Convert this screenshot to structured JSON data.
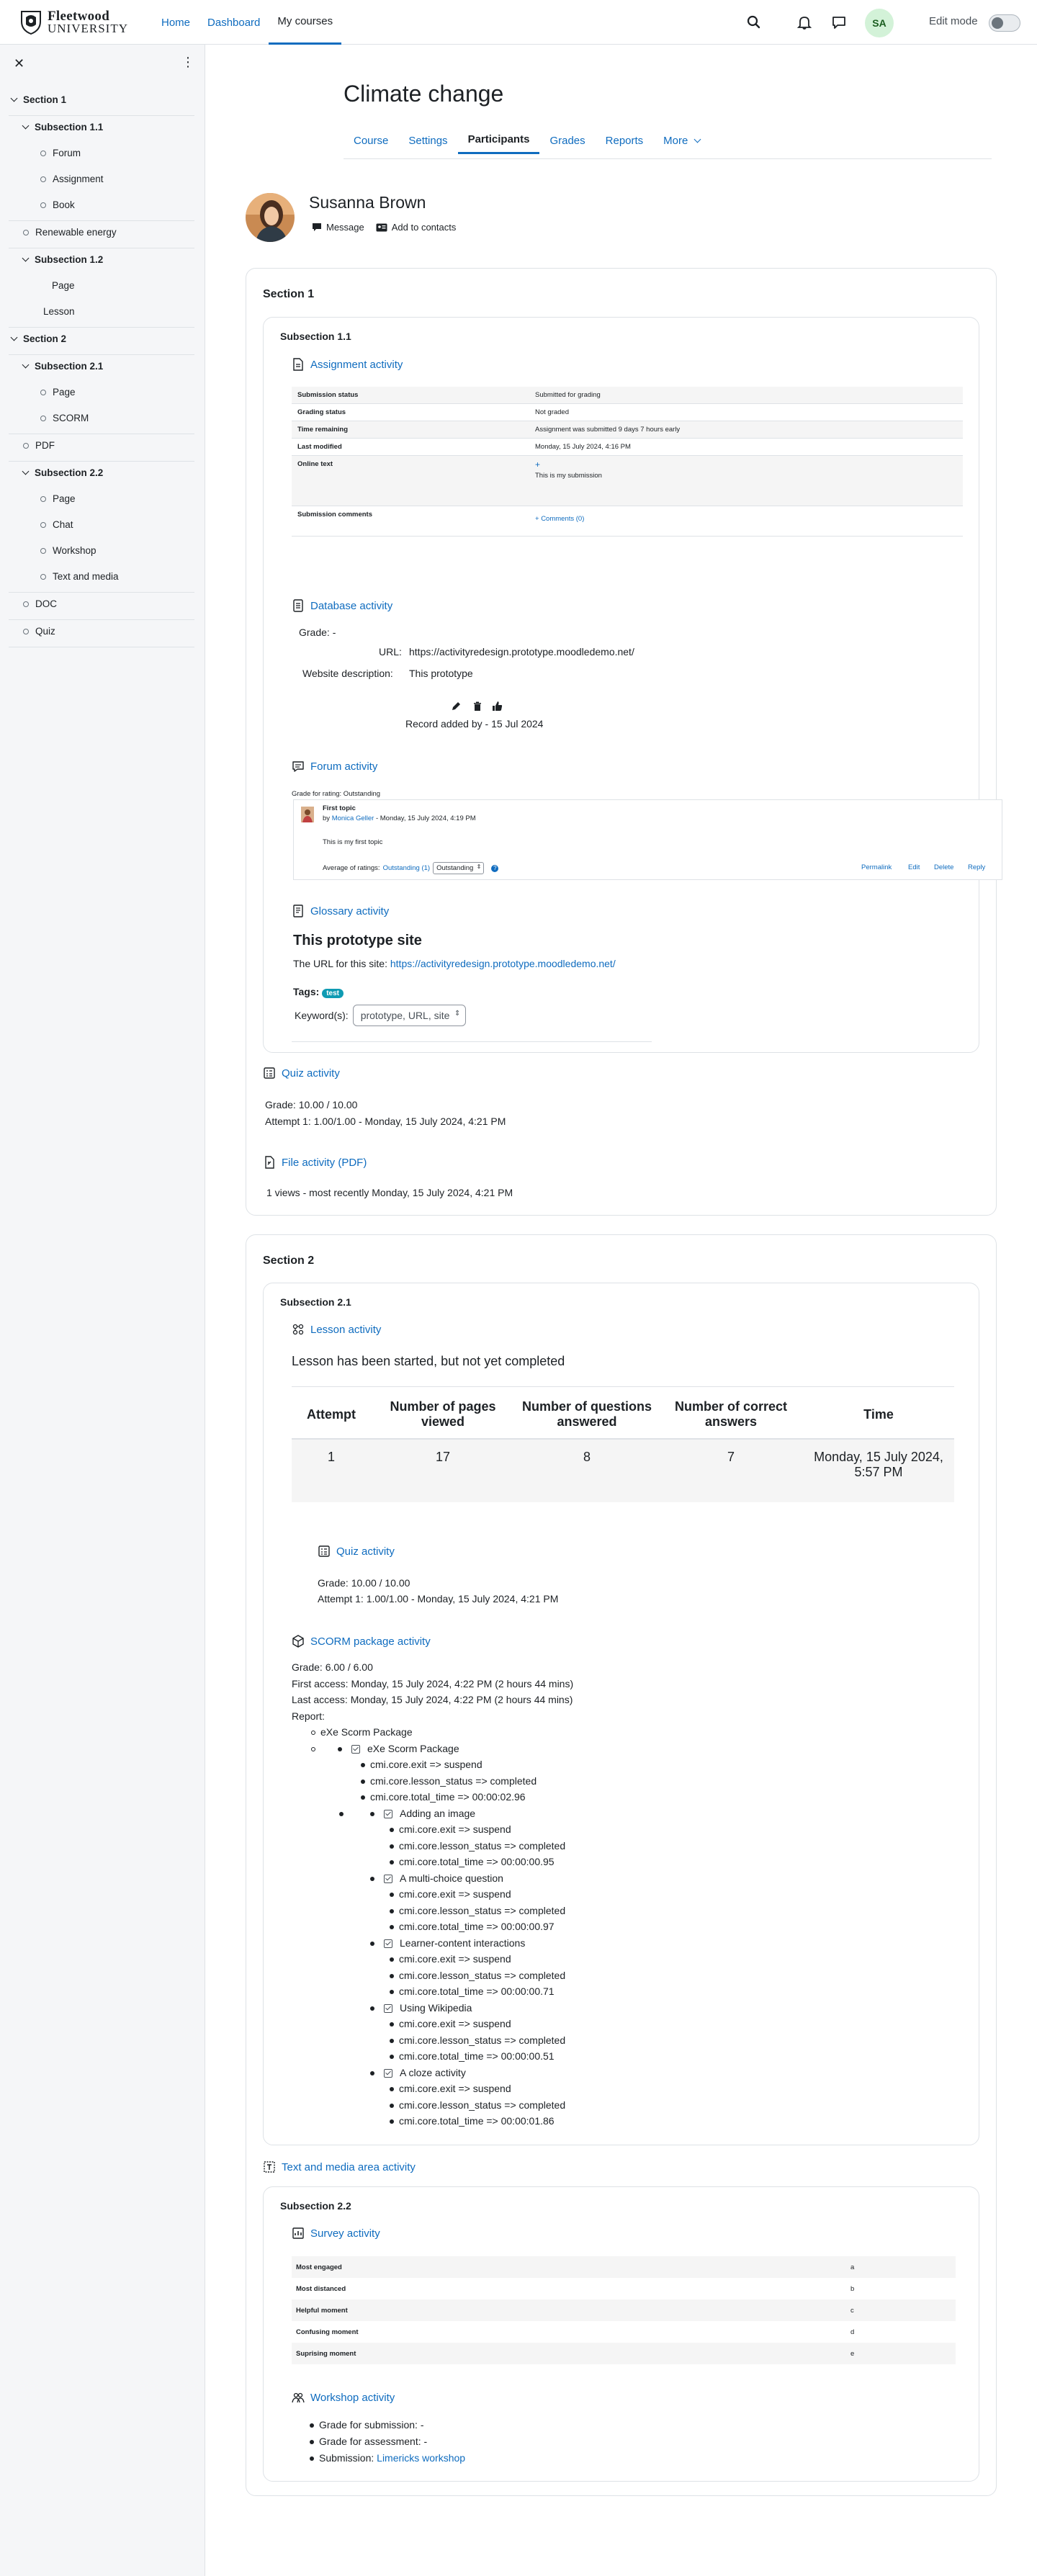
{
  "brand": {
    "line1": "Fleetwood",
    "line2": "UNIVERSITY"
  },
  "nav": {
    "items": [
      {
        "label": "Home",
        "active": false
      },
      {
        "label": "Dashboard",
        "active": false
      },
      {
        "label": "My courses",
        "active": true
      }
    ]
  },
  "user": {
    "initials": "SA",
    "edit_mode_label": "Edit mode"
  },
  "drawer": {
    "items": [
      {
        "label": "Section 1"
      },
      {
        "label": "Subsection 1.1"
      },
      {
        "label": "Forum"
      },
      {
        "label": "Assignment"
      },
      {
        "label": "Book"
      },
      {
        "label": "Renewable energy"
      },
      {
        "label": "Subsection 1.2"
      },
      {
        "label": "Page"
      },
      {
        "label": "Lesson"
      },
      {
        "label": "Section 2"
      },
      {
        "label": "Subsection 2.1"
      },
      {
        "label": "Page"
      },
      {
        "label": "SCORM"
      },
      {
        "label": "PDF"
      },
      {
        "label": "Subsection 2.2"
      },
      {
        "label": "Page"
      },
      {
        "label": "Chat"
      },
      {
        "label": "Workshop"
      },
      {
        "label": "Text and media"
      },
      {
        "label": "DOC"
      },
      {
        "label": "Quiz"
      }
    ]
  },
  "course": {
    "title": "Climate change",
    "tabs": [
      "Course",
      "Settings",
      "Participants",
      "Grades",
      "Reports",
      "More"
    ]
  },
  "participant": {
    "name": "Susanna Brown",
    "message": "Message",
    "add_contacts": "Add to contacts"
  },
  "section1": {
    "title": "Section 1",
    "subsection_title": "Subsection 1.1",
    "assignment": {
      "title": "Assignment activity",
      "rows": [
        {
          "label": "Submission status",
          "value": "Submitted for grading"
        },
        {
          "label": "Grading status",
          "value": "Not graded"
        },
        {
          "label": "Time remaining",
          "value": "Assignment was submitted 9 days 7 hours early"
        },
        {
          "label": "Last modified",
          "value": "Monday, 15 July 2024, 4:16 PM"
        },
        {
          "label": "Online text",
          "value": "This is my submission"
        },
        {
          "label": "Submission comments",
          "value": "Comments (0)"
        }
      ]
    },
    "database": {
      "title": "Database activity",
      "grade": "Grade: -",
      "url_label": "URL:",
      "url_value": "https://activityredesign.prototype.moodledemo.net/",
      "desc_label": "Website description:",
      "desc_value": "This prototype",
      "record": "Record added by - 15 Jul 2024"
    },
    "forum": {
      "title": "Forum activity",
      "grade": "Grade for rating: Outstanding",
      "post_title": "First topic",
      "by": "by",
      "author": "Monica Geller",
      "date": "- Monday, 15 July 2024, 4:19 PM",
      "body": "This is my first topic",
      "avg_label": "Average of ratings:",
      "avg_value": "Outstanding (1)",
      "rating_select": "Outstanding",
      "actions": [
        "Permalink",
        "Edit",
        "Delete",
        "Reply"
      ]
    },
    "glossary": {
      "title": "Glossary activity",
      "entry": "This prototype site",
      "url_text": "The URL for this site:",
      "url": "https://activityredesign.prototype.moodledemo.net/",
      "tags_label": "Tags:",
      "tag": "test",
      "keywords_label": "Keyword(s):",
      "keywords": "prototype, URL, site"
    },
    "quiz": {
      "title": "Quiz activity",
      "grade": "Grade: 10.00 / 10.00",
      "attempt": "Attempt 1: 1.00/1.00 - Monday, 15 July 2024, 4:21 PM"
    },
    "file": {
      "title": "File activity (PDF)",
      "views": "1 views - most recently Monday, 15 July 2024, 4:21 PM"
    }
  },
  "section2": {
    "title": "Section 2",
    "subsection_title": "Subsection 2.1",
    "lesson": {
      "title": "Lesson activity",
      "status": "Lesson has been started, but not yet completed",
      "headers": [
        "Attempt",
        "Number of pages viewed",
        "Number of questions answered",
        "Number of correct answers",
        "Time"
      ],
      "row": [
        "1",
        "17",
        "8",
        "7",
        "Monday, 15 July 2024, 5:57 PM"
      ]
    },
    "quiz": {
      "title": "Quiz activity",
      "grade": "Grade: 10.00 / 10.00",
      "attempt": "Attempt 1: 1.00/1.00 - Monday, 15 July 2024, 4:21 PM"
    },
    "scorm": {
      "title": "SCORM package activity",
      "grade": "Grade: 6.00 / 6.00",
      "first": "First access: Monday, 15 July 2024, 4:22 PM (2 hours 44 mins)",
      "last": "Last access: Monday, 15 July 2024, 4:22 PM (2 hours 44 mins)",
      "report": "Report:",
      "package": "eXe Scorm Package",
      "root": {
        "name": "eXe Scorm Package",
        "exit": "cmi.core.exit => suspend",
        "status": "cmi.core.lesson_status => completed",
        "time": "cmi.core.total_time => 00:00:02.96"
      },
      "children": [
        {
          "name": "Adding an image",
          "exit": "cmi.core.exit => suspend",
          "status": "cmi.core.lesson_status => completed",
          "time": "cmi.core.total_time => 00:00:00.95"
        },
        {
          "name": "A multi-choice question",
          "exit": "cmi.core.exit => suspend",
          "status": "cmi.core.lesson_status => completed",
          "time": "cmi.core.total_time => 00:00:00.97"
        },
        {
          "name": "Learner-content interactions",
          "exit": "cmi.core.exit => suspend",
          "status": "cmi.core.lesson_status => completed",
          "time": "cmi.core.total_time => 00:00:00.71"
        },
        {
          "name": "Using Wikipedia",
          "exit": "cmi.core.exit => suspend",
          "status": "cmi.core.lesson_status => completed",
          "time": "cmi.core.total_time => 00:00:00.51"
        },
        {
          "name": "A cloze activity",
          "exit": "cmi.core.exit => suspend",
          "status": "cmi.core.lesson_status => completed",
          "time": "cmi.core.total_time => 00:00:01.86"
        }
      ]
    },
    "textmedia": {
      "title": "Text and media area activity"
    },
    "subsection2_title": "Subsection 2.2",
    "survey": {
      "title": "Survey activity",
      "rows": [
        {
          "label": "Most engaged",
          "value": "a"
        },
        {
          "label": "Most distanced",
          "value": "b"
        },
        {
          "label": "Helpful moment",
          "value": "c"
        },
        {
          "label": "Confusing moment",
          "value": "d"
        },
        {
          "label": "Suprising moment",
          "value": "e"
        }
      ]
    },
    "workshop": {
      "title": "Workshop activity",
      "grade_sub": "Grade for submission: -",
      "grade_assess": "Grade for assessment: -",
      "submission_label": "Submission:",
      "submission_link": "Limericks workshop"
    }
  },
  "colors": {
    "accent": "#0f6cbf",
    "tag": "#0f9bb3",
    "avatar_bg": "#d3f2d8"
  }
}
